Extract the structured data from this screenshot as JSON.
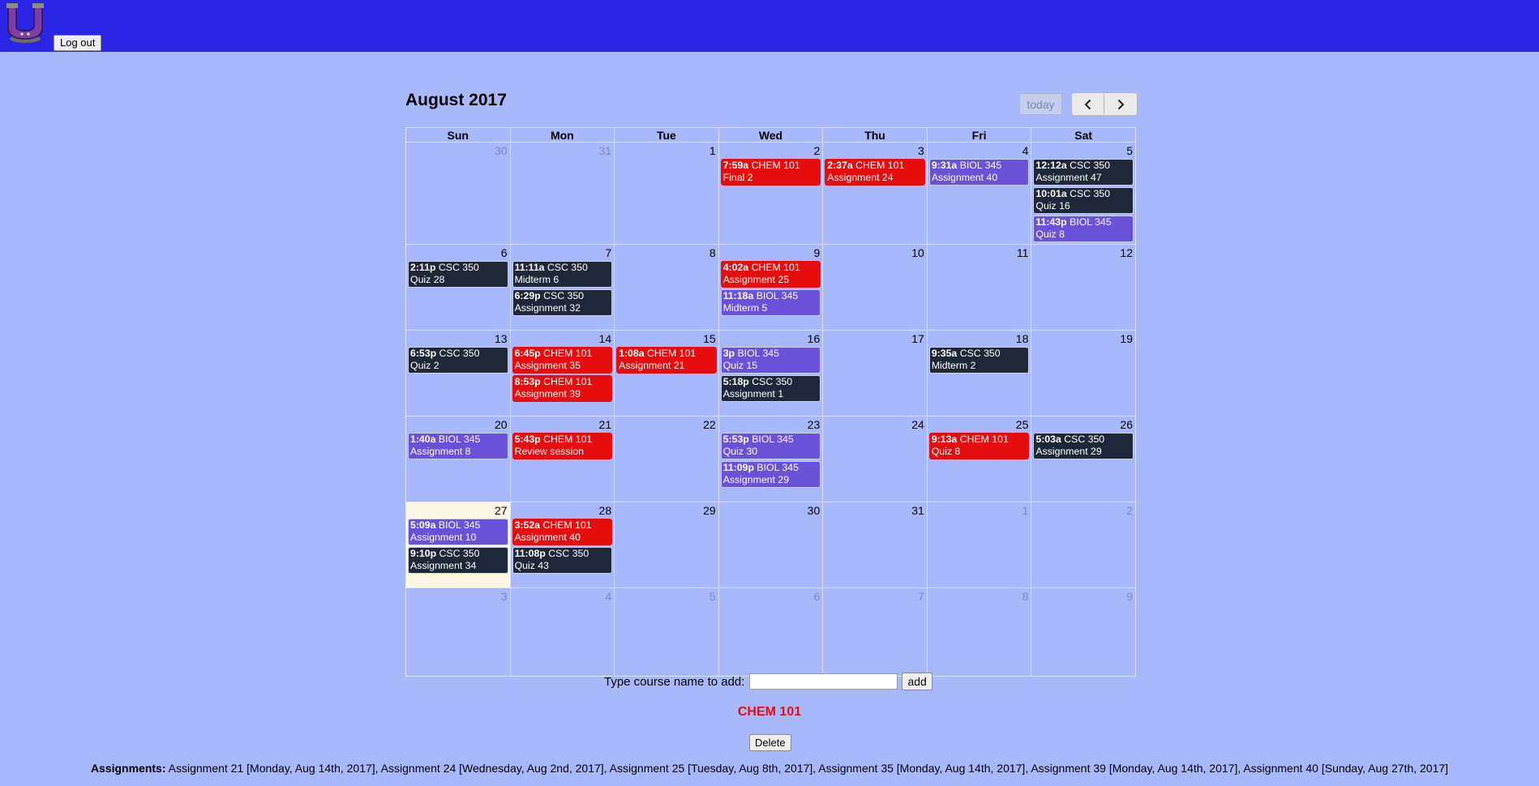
{
  "header": {
    "logout_label": "Log out"
  },
  "calendar": {
    "title": "August 2017",
    "today_label": "today",
    "weekdays": [
      "Sun",
      "Mon",
      "Tue",
      "Wed",
      "Thu",
      "Fri",
      "Sat"
    ],
    "weeks": [
      [
        {
          "d": "30",
          "other": true,
          "events": []
        },
        {
          "d": "31",
          "other": true,
          "events": []
        },
        {
          "d": "1",
          "events": []
        },
        {
          "d": "2",
          "events": [
            {
              "time": "7:59a",
              "course": "CHEM 101",
              "title": "Final 2",
              "type": "chem"
            }
          ]
        },
        {
          "d": "3",
          "events": [
            {
              "time": "2:37a",
              "course": "CHEM 101",
              "title": "Assignment 24",
              "type": "chem"
            }
          ]
        },
        {
          "d": "4",
          "events": [
            {
              "time": "9:31a",
              "course": "BIOL 345",
              "title": "Assignment 40",
              "type": "biol"
            }
          ]
        },
        {
          "d": "5",
          "events": [
            {
              "time": "12:12a",
              "course": "CSC 350",
              "title": "Assignment 47",
              "type": "csc"
            },
            {
              "time": "10:01a",
              "course": "CSC 350",
              "title": "Quiz 16",
              "type": "csc"
            },
            {
              "time": "11:43p",
              "course": "BIOL 345",
              "title": "Quiz 8",
              "type": "biol"
            }
          ]
        }
      ],
      [
        {
          "d": "6",
          "events": [
            {
              "time": "2:11p",
              "course": "CSC 350",
              "title": "Quiz 28",
              "type": "csc"
            }
          ]
        },
        {
          "d": "7",
          "events": [
            {
              "time": "11:11a",
              "course": "CSC 350",
              "title": "Midterm 6",
              "type": "csc"
            },
            {
              "time": "6:29p",
              "course": "CSC 350",
              "title": "Assignment 32",
              "type": "csc"
            }
          ]
        },
        {
          "d": "8",
          "events": []
        },
        {
          "d": "9",
          "events": [
            {
              "time": "4:02a",
              "course": "CHEM 101",
              "title": "Assignment 25",
              "type": "chem"
            },
            {
              "time": "11:18a",
              "course": "BIOL 345",
              "title": "Midterm 5",
              "type": "biol"
            }
          ]
        },
        {
          "d": "10",
          "events": []
        },
        {
          "d": "11",
          "events": []
        },
        {
          "d": "12",
          "events": []
        }
      ],
      [
        {
          "d": "13",
          "events": [
            {
              "time": "6:53p",
              "course": "CSC 350",
              "title": "Quiz 2",
              "type": "csc"
            }
          ]
        },
        {
          "d": "14",
          "events": [
            {
              "time": "6:45p",
              "course": "CHEM 101",
              "title": "Assignment 35",
              "type": "chem"
            },
            {
              "time": "8:53p",
              "course": "CHEM 101",
              "title": "Assignment 39",
              "type": "chem"
            }
          ]
        },
        {
          "d": "15",
          "events": [
            {
              "time": "1:08a",
              "course": "CHEM 101",
              "title": "Assignment 21",
              "type": "chem"
            }
          ]
        },
        {
          "d": "16",
          "events": [
            {
              "time": "3p",
              "course": "BIOL 345",
              "title": "Quiz 15",
              "type": "biol"
            },
            {
              "time": "5:18p",
              "course": "CSC 350",
              "title": "Assignment 1",
              "type": "csc"
            }
          ]
        },
        {
          "d": "17",
          "events": []
        },
        {
          "d": "18",
          "events": [
            {
              "time": "9:35a",
              "course": "CSC 350",
              "title": "Midterm 2",
              "type": "csc"
            }
          ]
        },
        {
          "d": "19",
          "events": []
        }
      ],
      [
        {
          "d": "20",
          "events": [
            {
              "time": "1:40a",
              "course": "BIOL 345",
              "title": "Assignment 8",
              "type": "biol"
            }
          ]
        },
        {
          "d": "21",
          "events": [
            {
              "time": "5:43p",
              "course": "CHEM 101",
              "title": "Review session",
              "type": "chem"
            }
          ]
        },
        {
          "d": "22",
          "events": []
        },
        {
          "d": "23",
          "events": [
            {
              "time": "5:53p",
              "course": "BIOL 345",
              "title": "Quiz 30",
              "type": "biol"
            },
            {
              "time": "11:09p",
              "course": "BIOL 345",
              "title": "Assignment 29",
              "type": "biol"
            }
          ]
        },
        {
          "d": "24",
          "events": []
        },
        {
          "d": "25",
          "events": [
            {
              "time": "9:13a",
              "course": "CHEM 101",
              "title": "Quiz 8",
              "type": "chem"
            }
          ]
        },
        {
          "d": "26",
          "events": [
            {
              "time": "5:03a",
              "course": "CSC 350",
              "title": "Assignment 29",
              "type": "csc"
            }
          ]
        }
      ],
      [
        {
          "d": "27",
          "today": true,
          "events": [
            {
              "time": "5:09a",
              "course": "BIOL 345",
              "title": "Assignment 10",
              "type": "biol"
            },
            {
              "time": "9:10p",
              "course": "CSC 350",
              "title": "Assignment 34",
              "type": "csc"
            }
          ]
        },
        {
          "d": "28",
          "events": [
            {
              "time": "3:52a",
              "course": "CHEM 101",
              "title": "Assignment 40",
              "type": "chem"
            },
            {
              "time": "11:08p",
              "course": "CSC 350",
              "title": "Quiz 43",
              "type": "csc"
            }
          ]
        },
        {
          "d": "29",
          "events": []
        },
        {
          "d": "30",
          "events": []
        },
        {
          "d": "31",
          "events": []
        },
        {
          "d": "1",
          "other": true,
          "events": []
        },
        {
          "d": "2",
          "other": true,
          "events": []
        }
      ],
      [
        {
          "d": "3",
          "other": true,
          "events": []
        },
        {
          "d": "4",
          "other": true,
          "events": []
        },
        {
          "d": "5",
          "other": true,
          "events": []
        },
        {
          "d": "6",
          "other": true,
          "events": []
        },
        {
          "d": "7",
          "other": true,
          "events": []
        },
        {
          "d": "8",
          "other": true,
          "events": []
        },
        {
          "d": "9",
          "other": true,
          "events": []
        }
      ]
    ]
  },
  "add_course": {
    "label": "Type course name to add:",
    "input_value": "",
    "button_label": "add"
  },
  "selected_course": {
    "name": "CHEM 101",
    "delete_label": "Delete"
  },
  "assignments": {
    "label": "Assignments:",
    "text": "Assignment 21 [Monday, Aug 14th, 2017], Assignment 24 [Wednesday, Aug 2nd, 2017], Assignment 25 [Tuesday, Aug 8th, 2017], Assignment 35 [Monday, Aug 14th, 2017], Assignment 39 [Monday, Aug 14th, 2017], Assignment 40 [Sunday, Aug 27th, 2017]"
  },
  "colors": {
    "chem": "#e50d0d",
    "csc": "#1e2838",
    "biol": "#6a52d8",
    "header": "#2b25e6",
    "page": "#a8b8fd"
  }
}
